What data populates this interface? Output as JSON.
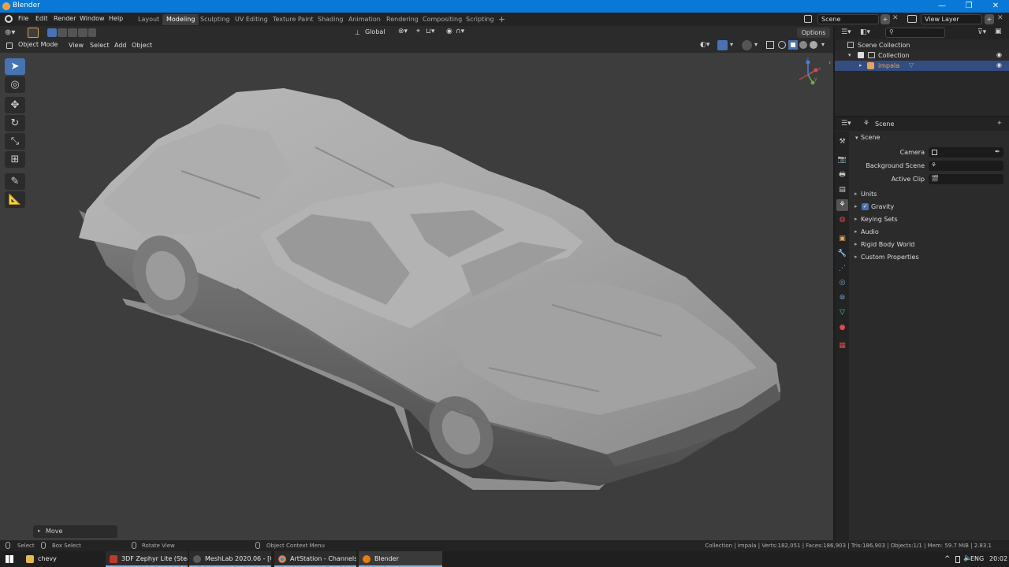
{
  "window": {
    "title": "Blender",
    "controls": [
      "—",
      "❐",
      "✕"
    ]
  },
  "menus": [
    "File",
    "Edit",
    "Render",
    "Window",
    "Help"
  ],
  "workspaces": [
    "Layout",
    "Modeling",
    "Sculpting",
    "UV Editing",
    "Texture Paint",
    "Shading",
    "Animation",
    "Rendering",
    "Compositing",
    "Scripting",
    "+"
  ],
  "active_workspace": "Modeling",
  "scene_selector": {
    "label": "Scene"
  },
  "view_layer_selector": {
    "label": "View Layer"
  },
  "viewport_header": {
    "orientation": "Global",
    "options": "Options",
    "mode": "Object Mode",
    "menus": [
      "View",
      "Select",
      "Add",
      "Object"
    ]
  },
  "gizmo": {
    "x": "x",
    "y": "y",
    "z": "z"
  },
  "last_operator": {
    "label": "Move"
  },
  "outliner": {
    "search_placeholder": "",
    "items": [
      {
        "label": "Scene Collection"
      },
      {
        "label": "Collection"
      },
      {
        "label": "impala"
      }
    ]
  },
  "properties": {
    "context_label": "Scene",
    "panel_title": "Scene",
    "fields": [
      {
        "label": "Camera",
        "value": ""
      },
      {
        "label": "Background Scene",
        "value": ""
      },
      {
        "label": "Active Clip",
        "value": ""
      }
    ],
    "sections": [
      {
        "label": "Units"
      },
      {
        "label": "Gravity",
        "checked": true
      },
      {
        "label": "Keying Sets"
      },
      {
        "label": "Audio"
      },
      {
        "label": "Rigid Body World"
      },
      {
        "label": "Custom Properties"
      }
    ]
  },
  "statusbar": {
    "hints": [
      "Select",
      "Box Select",
      "Rotate View",
      "Object Context Menu"
    ],
    "stats": "Collection | impala | Verts:182,051 | Faces:186,903 | Tris:186,903 | Objects:1/1 | Mem: 59.7 MiB | 2.83.1"
  },
  "taskbar": {
    "items": [
      {
        "label": "chevy",
        "color": "#e8b84a"
      },
      {
        "label": "3DF Zephyr Lite (Stea...",
        "color": "#c0392b"
      },
      {
        "label": "MeshLab 2020.06 - [C...",
        "color": "#5a5a5a"
      },
      {
        "label": "ArtStation - Channels...",
        "color": "#3b8be0"
      },
      {
        "label": "Blender",
        "color": "#e87d0d"
      }
    ],
    "tray": {
      "lang": "ENG",
      "time": "20:02",
      "chevron": "^"
    }
  },
  "colors": {
    "accent": "#4772b3",
    "titlebar": "#0a78d7",
    "viewport": "#3d3d3d",
    "selection_text": "#e8a35a"
  }
}
